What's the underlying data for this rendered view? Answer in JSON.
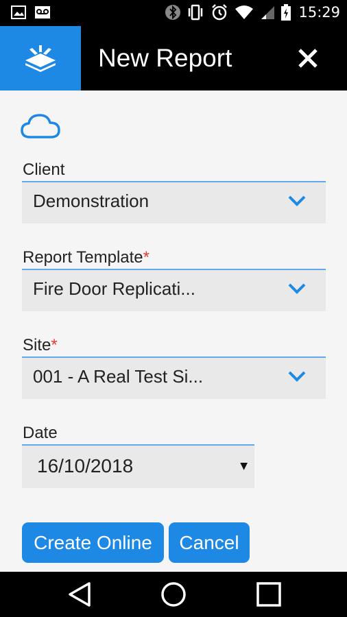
{
  "status_bar": {
    "time": "15:29",
    "icons": [
      "image-icon",
      "voicemail-icon",
      "bluetooth-icon",
      "vibrate-icon",
      "alarm-icon",
      "wifi-icon",
      "signal-icon",
      "battery-charging-icon"
    ]
  },
  "app_bar": {
    "title": "New Report",
    "logo_icon": "stack-logo-icon",
    "close_icon": "close-icon"
  },
  "form": {
    "sync_icon": "cloud-icon",
    "client": {
      "label": "Client",
      "value": "Demonstration"
    },
    "report_template": {
      "label": "Report Template",
      "required_mark": "*",
      "value": "Fire Door Replicati..."
    },
    "site": {
      "label": "Site",
      "required_mark": "*",
      "value": "001 - A Real Test Si..."
    },
    "date": {
      "label": "Date",
      "value": "16/10/2018"
    }
  },
  "buttons": {
    "create_online": "Create Online",
    "cancel": "Cancel"
  },
  "nav": {
    "back_icon": "back-triangle-icon",
    "home_icon": "home-circle-icon",
    "recents_icon": "recents-square-icon"
  },
  "colors": {
    "accent": "#1e88e5",
    "required": "#e53935",
    "field_bg": "#e9e9e9",
    "page_bg": "#f5f5f5"
  }
}
